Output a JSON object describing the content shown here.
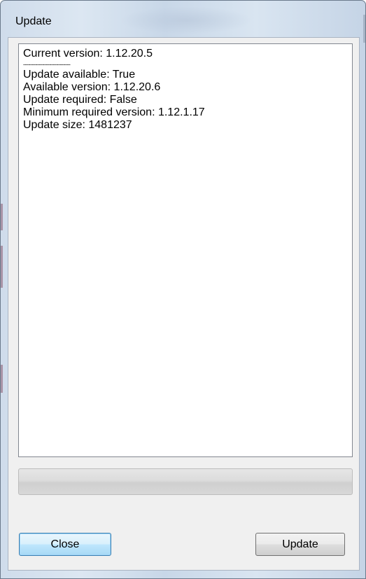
{
  "window": {
    "title": "Update"
  },
  "output": {
    "lines": [
      "Current version: 1.12.20.5",
      "---------------------------",
      "Update available: True",
      "Available version: 1.12.20.6",
      "Update required: False",
      "Minimum required version: 1.12.1.17",
      "Update size: 1481237"
    ]
  },
  "progress": {
    "value_percent": 0
  },
  "buttons": {
    "close_label": "Close",
    "update_label": "Update"
  },
  "colors": {
    "default_button_border": "#3c7fb1",
    "progress_fill": "#06b025"
  }
}
